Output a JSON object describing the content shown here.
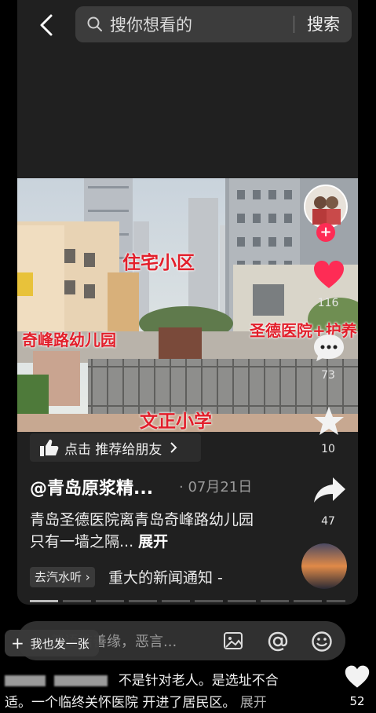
{
  "search": {
    "placeholder": "搜你想看的",
    "button_label": "搜索"
  },
  "photo": {
    "labels": {
      "residential": "住宅小区",
      "kindergarten": "奇峰路幼儿园",
      "hospital": "圣德医院+护养",
      "school": "文正小学"
    }
  },
  "recommend": {
    "label": "点击 推荐给朋友"
  },
  "post": {
    "author": "@青岛原浆精...",
    "date": "· 07月21日",
    "description": "青岛圣德医院离青岛奇峰路幼儿园只有一墙之隔...",
    "expand": "展开",
    "tag": "去汽水听",
    "music": "重大的新闻通知 -"
  },
  "rail": {
    "like_count": "116",
    "comment_count": "73",
    "favorite_count": "10",
    "share_count": "47"
  },
  "comment_bar": {
    "placeholder": "善语结善缘，恶言..."
  },
  "post_button": {
    "label": "我也发一张"
  },
  "comment": {
    "line1": "不是针对老人。是选址不合",
    "line2": "适。一个临终关怀医院 开进了居民区。",
    "expand": "展开",
    "like_count": "52"
  },
  "colors": {
    "like": "#fe2c55",
    "overlay_text": "#e21f2b",
    "card": "#202020"
  }
}
